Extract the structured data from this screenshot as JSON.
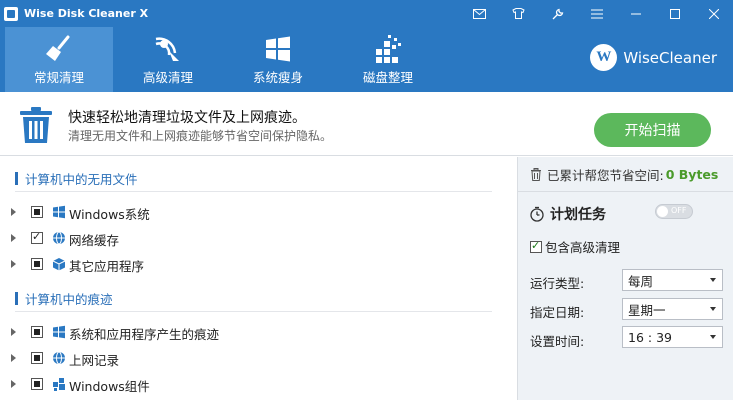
{
  "window": {
    "title": "Wise Disk Cleaner X"
  },
  "nav": {
    "tabs": [
      {
        "label": "常规清理",
        "icon": "broom-icon",
        "active": true
      },
      {
        "label": "高级清理",
        "icon": "advanced-clean-icon",
        "active": false
      },
      {
        "label": "系统瘦身",
        "icon": "windows-icon",
        "active": false
      },
      {
        "label": "磁盘整理",
        "icon": "defrag-icon",
        "active": false
      }
    ],
    "brand": "WiseCleaner",
    "brand_logo_letter": "W"
  },
  "header": {
    "title": "快速轻松地清理垃圾文件及上网痕迹。",
    "subtitle": "清理无用文件和上网痕迹能够节省空间保护隐私。",
    "scan_button": "开始扫描"
  },
  "sections": [
    {
      "title": "计算机中的无用文件",
      "items": [
        {
          "label": "Windows系统",
          "icon": "windows-icon",
          "check": "partial"
        },
        {
          "label": "网络缓存",
          "icon": "globe-icon",
          "check": "checked"
        },
        {
          "label": "其它应用程序",
          "icon": "cube-icon",
          "check": "partial"
        }
      ]
    },
    {
      "title": "计算机中的痕迹",
      "items": [
        {
          "label": "系统和应用程序产生的痕迹",
          "icon": "windows-icon",
          "check": "partial"
        },
        {
          "label": "上网记录",
          "icon": "globe-icon",
          "check": "partial"
        },
        {
          "label": "Windows组件",
          "icon": "puzzle-icon",
          "check": "partial"
        }
      ]
    }
  ],
  "right": {
    "saved_label": "已累计帮您节省空间:",
    "saved_value": "0 Bytes",
    "schedule_title": "计划任务",
    "toggle_label": "OFF",
    "include_advanced": "包含高级清理",
    "run_type_label": "运行类型:",
    "run_type_value": "每周",
    "date_label": "指定日期:",
    "date_value": "星期一",
    "time_label": "设置时间:",
    "time_value": "16 : 39"
  },
  "colors": {
    "primary": "#2a78c2",
    "active_tab": "#4b92d4",
    "scan_green": "#5cb85c",
    "section_blue": "#2a6fb8",
    "saved_green": "#4a9a2a"
  }
}
